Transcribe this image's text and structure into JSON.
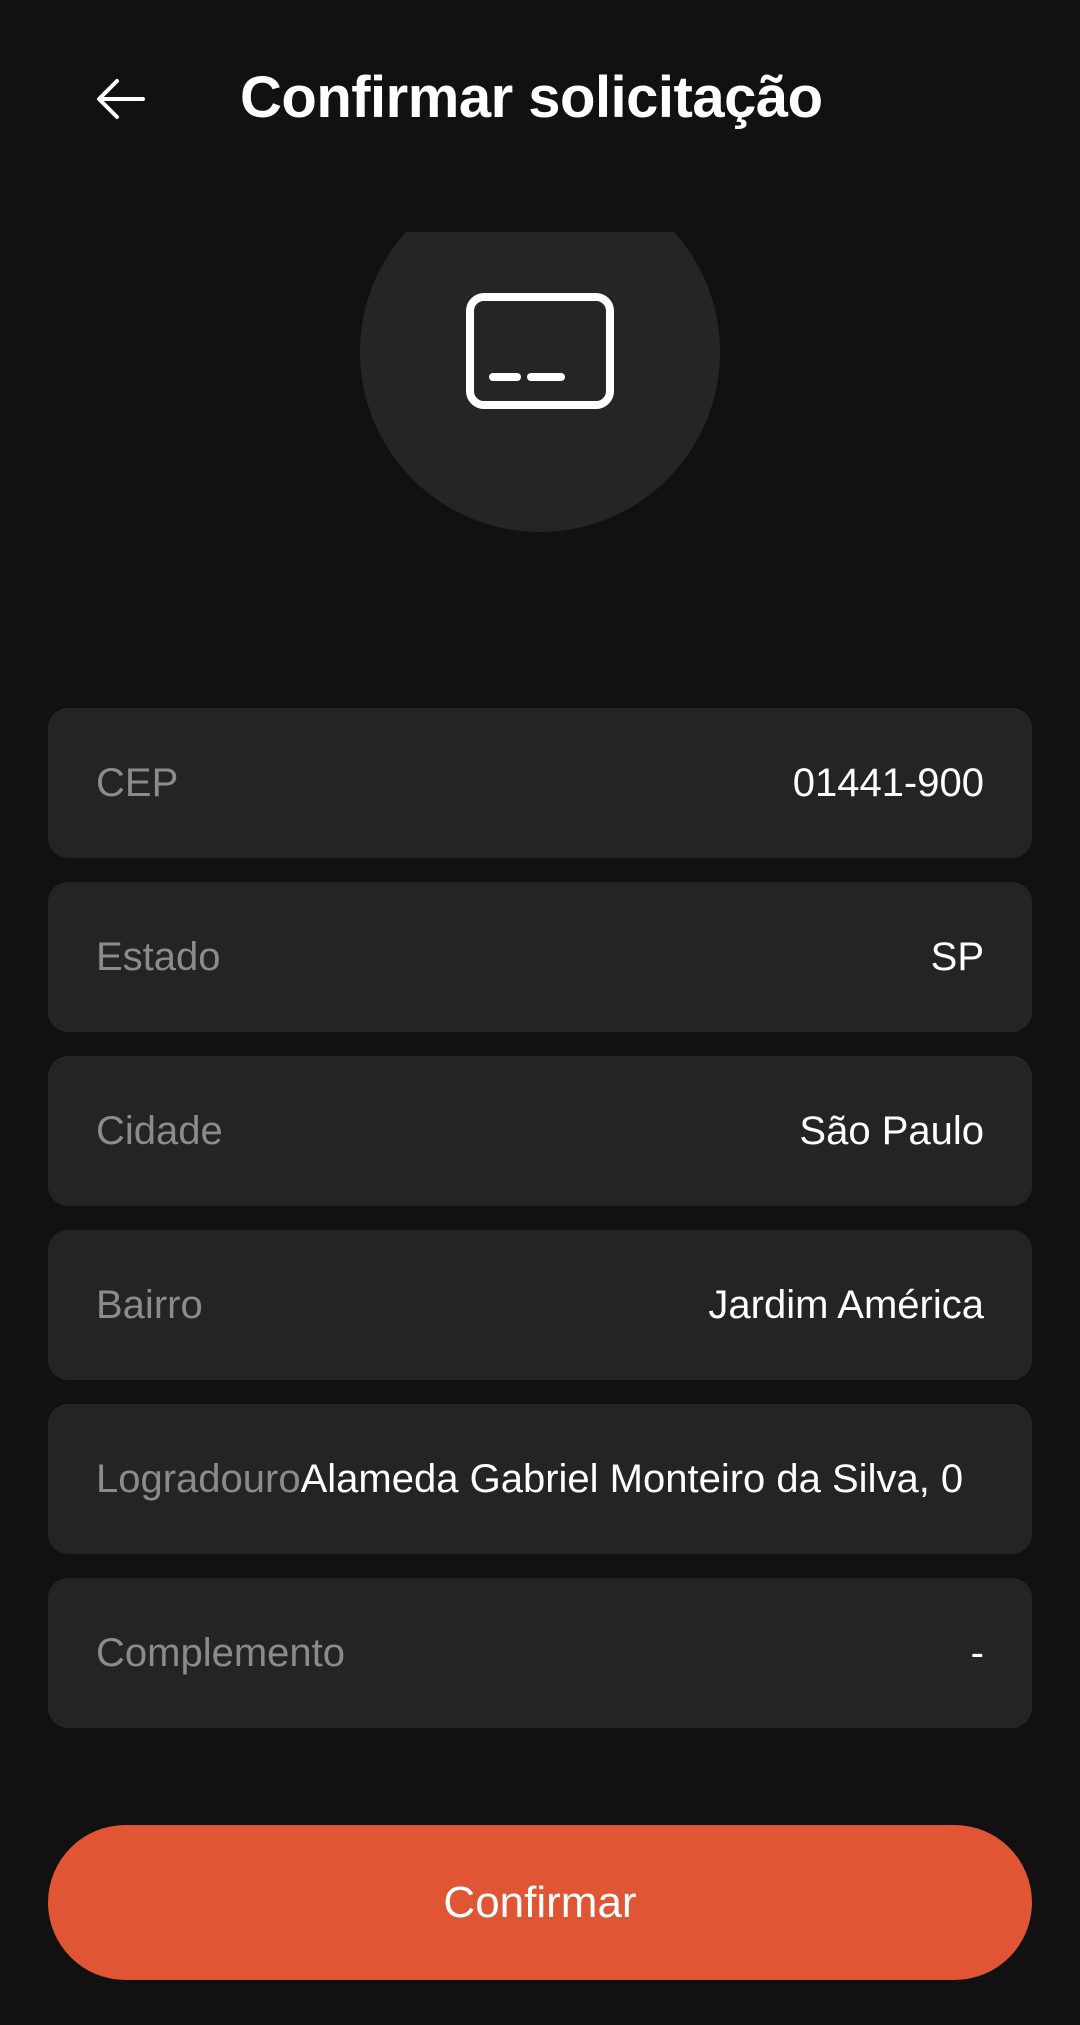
{
  "header": {
    "title": "Confirmar solicitação",
    "back_icon": "arrow-left-icon"
  },
  "hero": {
    "icon": "card-icon"
  },
  "fields": [
    {
      "label": "CEP",
      "value": "01441-900"
    },
    {
      "label": "Estado",
      "value": "SP"
    },
    {
      "label": "Cidade",
      "value": "São Paulo"
    },
    {
      "label": "Bairro",
      "value": "Jardim América"
    },
    {
      "label": "Logradouro",
      "value": "Alameda Gabriel Monteiro da Silva, 0"
    },
    {
      "label": "Complemento",
      "value": "-"
    }
  ],
  "actions": {
    "confirm_label": "Confirmar"
  },
  "colors": {
    "background": "#111111",
    "field_background": "#242424",
    "accent": "#e05534",
    "label_text": "#8b8b8b",
    "value_text": "#ffffff"
  }
}
